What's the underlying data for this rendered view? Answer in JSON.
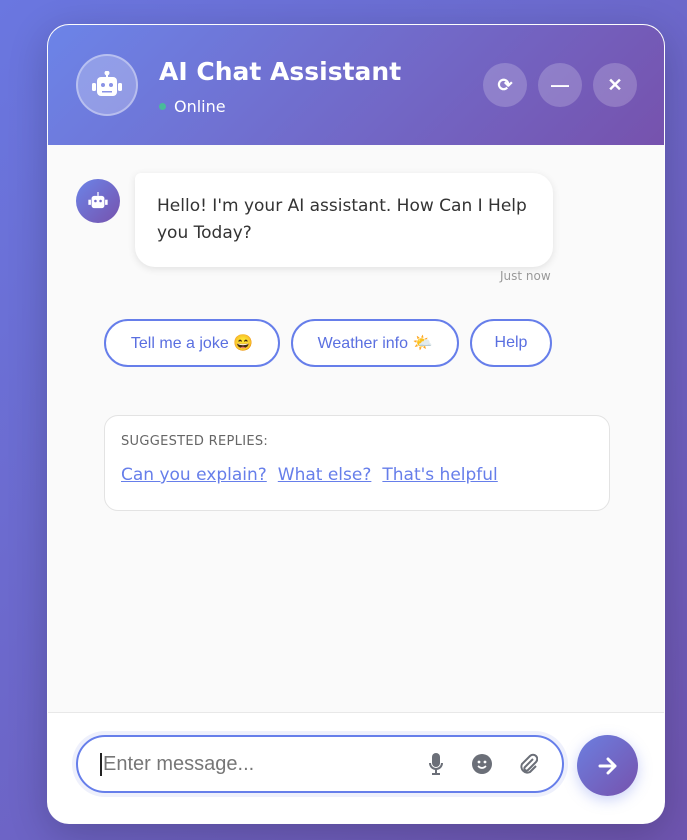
{
  "header": {
    "title": "AI Chat Assistant",
    "status": "Online",
    "buttons": [
      "refresh",
      "minimize",
      "close"
    ]
  },
  "messages": [
    {
      "sender": "bot",
      "text": "Hello! I'm your AI assistant. How Can I Help you Today?",
      "time": "Just now"
    }
  ],
  "quick_replies": [
    {
      "label": "Tell me a joke 😄"
    },
    {
      "label": "Weather info 🌤️"
    },
    {
      "label": "Help"
    }
  ],
  "suggested": {
    "title": "SUGGESTED REPLIES:",
    "items": [
      "Can you explain?",
      "What else?",
      "That's helpful"
    ]
  },
  "input": {
    "placeholder": "Enter message...",
    "value": ""
  },
  "colors": {
    "accent": "#667eea",
    "accent2": "#764ba2",
    "online": "#48bb9a"
  }
}
